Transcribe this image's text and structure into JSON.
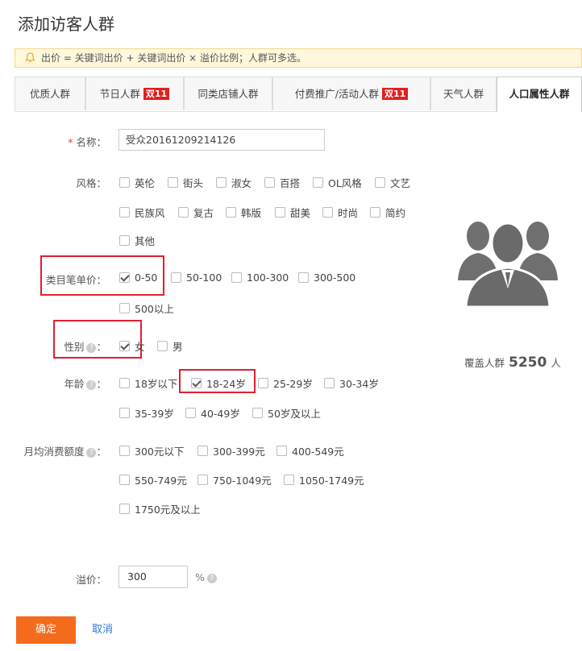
{
  "page_title": "添加访客人群",
  "notice_text": "出价 = 关键词出价 + 关键词出价 × 溢价比例；人群可多选。",
  "tabs": [
    {
      "label": "优质人群",
      "badge": ""
    },
    {
      "label": "节日人群",
      "badge": "双11"
    },
    {
      "label": "同类店铺人群",
      "badge": ""
    },
    {
      "label": "付费推广/活动人群",
      "badge": "双11"
    },
    {
      "label": "天气人群",
      "badge": ""
    },
    {
      "label": "人口属性人群",
      "badge": ""
    }
  ],
  "form": {
    "name_label": "名称：",
    "name_value": "受众20161209214126",
    "style_label": "风格：",
    "style_options": [
      "英伦",
      "街头",
      "淑女",
      "百搭",
      "OL风格",
      "文艺",
      "民族风",
      "复古",
      "韩版",
      "甜美",
      "时尚",
      "简约",
      "其他"
    ],
    "price_label": "类目笔单价：",
    "price_options": [
      {
        "label": "0-50",
        "checked": true
      },
      {
        "label": "50-100",
        "checked": false
      },
      {
        "label": "100-300",
        "checked": false
      },
      {
        "label": "300-500",
        "checked": false
      },
      {
        "label": "500以上",
        "checked": false
      }
    ],
    "gender_label": "性别",
    "gender_options": [
      {
        "label": "女",
        "checked": true
      },
      {
        "label": "男",
        "checked": false
      }
    ],
    "age_label": "年龄",
    "age_options": [
      {
        "label": "18岁以下",
        "checked": false
      },
      {
        "label": "18-24岁",
        "checked": true
      },
      {
        "label": "25-29岁",
        "checked": false
      },
      {
        "label": "30-34岁",
        "checked": false
      },
      {
        "label": "35-39岁",
        "checked": false
      },
      {
        "label": "40-49岁",
        "checked": false
      },
      {
        "label": "50岁及以上",
        "checked": false
      }
    ],
    "spend_label": "月均消费额度",
    "spend_options": [
      "300元以下",
      "300-399元",
      "400-549元",
      "550-749元",
      "750-1049元",
      "1050-1749元",
      "1750元及以上"
    ],
    "premium_label": "溢价：",
    "premium_value": "300",
    "premium_unit": "%",
    "help_glyph": "?",
    "colon": "："
  },
  "coverage": {
    "prefix": "覆盖人群",
    "count": "5250",
    "suffix": "人"
  },
  "buttons": {
    "confirm": "确定",
    "cancel": "取消"
  },
  "colors": {
    "accent": "#f56b1c",
    "badge": "#e02020",
    "link": "#2a7ad3",
    "highlight_box": "#e02030"
  }
}
